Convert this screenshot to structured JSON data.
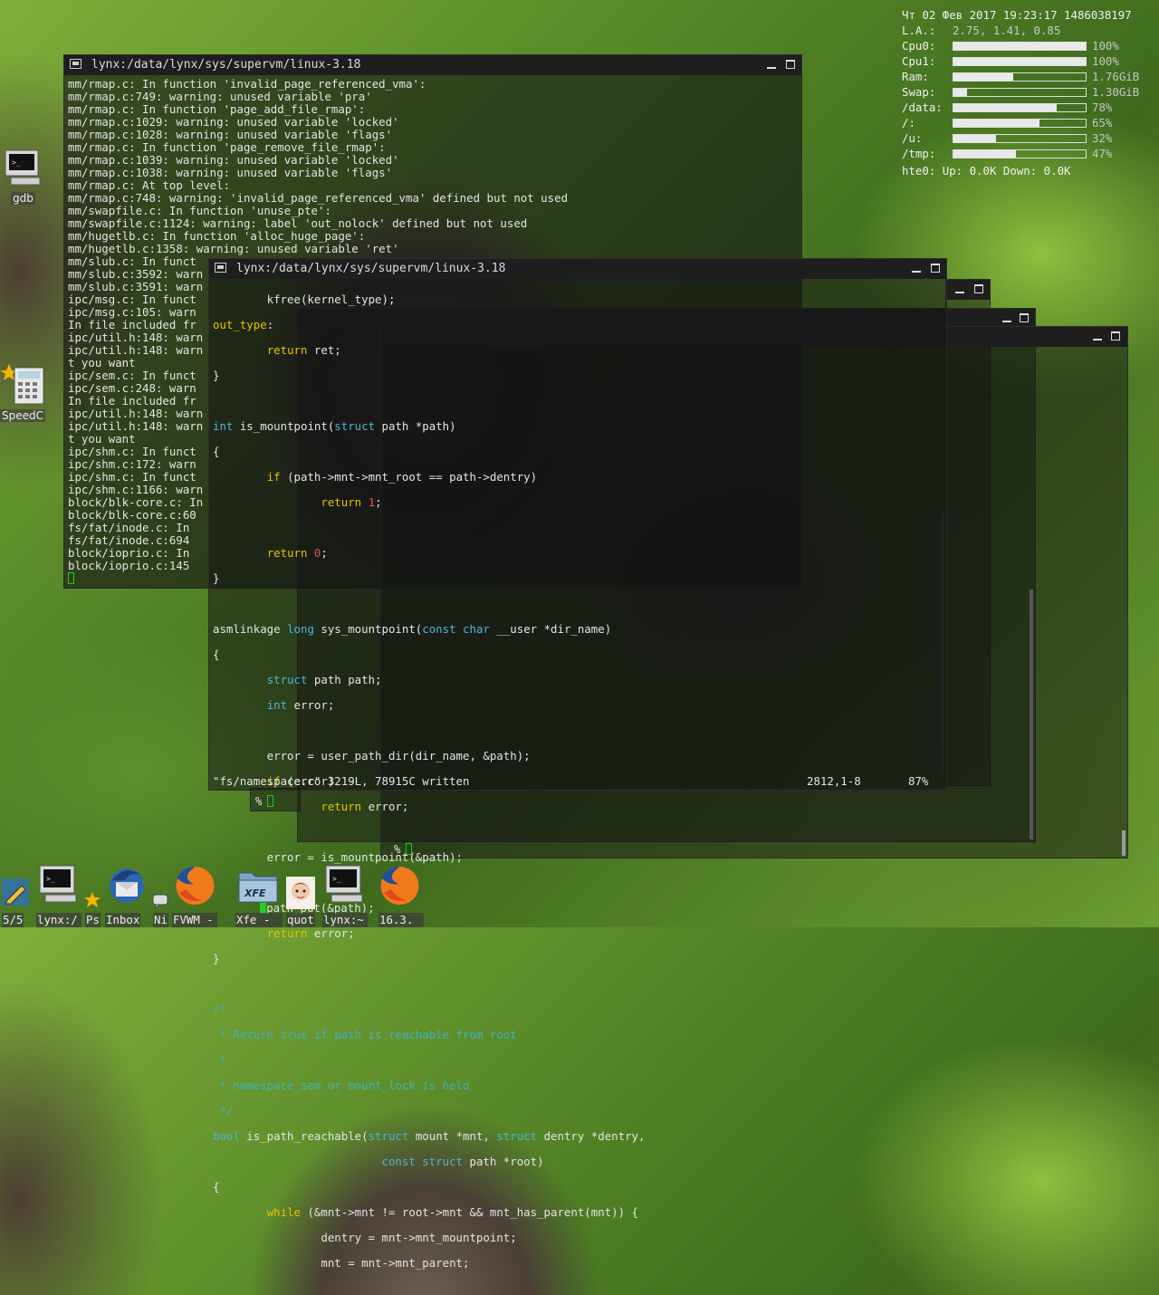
{
  "conky": {
    "datetime": "Чт 02 Фев 2017 19:23:17 1486038197",
    "load_label": "L.A.:",
    "load_value": "2.75, 1.41, 0.85",
    "meters": [
      {
        "label": "Cpu0:",
        "value": "100%",
        "level": 1.0
      },
      {
        "label": "Cpu1:",
        "value": "100%",
        "level": 1.0
      },
      {
        "label": "Ram:",
        "value": "1.76GiB",
        "level": 0.45
      },
      {
        "label": "Swap:",
        "value": "1.30GiB",
        "level": 0.1
      },
      {
        "label": "/data:",
        "value": "78%",
        "level": 0.78
      },
      {
        "label": "/:",
        "value": "65%",
        "level": 0.65
      },
      {
        "label": "/u:",
        "value": "32%",
        "level": 0.32
      },
      {
        "label": "/tmp:",
        "value": "47%",
        "level": 0.47
      }
    ],
    "net": "hte0: Up: 0.0K Down: 0.0K"
  },
  "window_back": {
    "title": "lynx:/data/lynx/sys/supervm/linux-3.18",
    "lines": [
      "mm/rmap.c: In function 'invalid_page_referenced_vma':",
      "mm/rmap.c:749: warning: unused variable 'pra'",
      "mm/rmap.c: In function 'page_add_file_rmap':",
      "mm/rmap.c:1029: warning: unused variable 'locked'",
      "mm/rmap.c:1028: warning: unused variable 'flags'",
      "mm/rmap.c: In function 'page_remove_file_rmap':",
      "mm/rmap.c:1039: warning: unused variable 'locked'",
      "mm/rmap.c:1038: warning: unused variable 'flags'",
      "mm/rmap.c: At top level:",
      "mm/rmap.c:748: warning: 'invalid_page_referenced_vma' defined but not used",
      "mm/swapfile.c: In function 'unuse_pte':",
      "mm/swapfile.c:1124: warning: label 'out_nolock' defined but not used",
      "mm/hugetlb.c: In function 'alloc_huge_page':",
      "mm/hugetlb.c:1358: warning: unused variable 'ret'",
      "mm/slub.c: In funct",
      "mm/slub.c:3592: warn",
      "mm/slub.c:3591: warn",
      "ipc/msg.c: In funct",
      "ipc/msg.c:105: warn",
      "In file included fr",
      "ipc/util.h:148: warn",
      "ipc/util.h:148: warn",
      "t you want",
      "ipc/sem.c: In funct",
      "ipc/sem.c:248: warn",
      "In file included fr",
      "ipc/util.h:148: warn",
      "ipc/util.h:148: warn",
      "t you want",
      "ipc/shm.c: In funct",
      "ipc/shm.c:172: warn",
      "ipc/shm.c: In funct",
      "ipc/shm.c:1166: warn",
      "block/blk-core.c: In",
      "block/blk-core.c:60",
      "fs/fat/inode.c: In",
      "fs/fat/inode.c:694",
      "block/ioprio.c: In",
      "block/ioprio.c:145"
    ]
  },
  "window_front": {
    "title": "lynx:/data/lynx/sys/supervm/linux-3.18",
    "status_file": "\"fs/namespace.c\" 3219L, 78915C written",
    "status_pos": "2812,1-8",
    "status_pct": "87%"
  },
  "small_windows": {
    "prompt": "%"
  },
  "desktop_icons": [
    {
      "label": "gdb"
    },
    {
      "label": "SpeedC"
    }
  ],
  "taskbar": {
    "pager": "5/5",
    "items": [
      {
        "label": "lynx:/"
      },
      {
        "label": "Ps"
      },
      {
        "label": "Inbox"
      },
      {
        "label": "Ni"
      },
      {
        "label": "FVWM -"
      },
      {
        "label": "Xfe -"
      },
      {
        "label": "quot"
      },
      {
        "label": "lynx:~"
      },
      {
        "label": "16.3."
      }
    ],
    "xfe_logo": "XFE"
  },
  "colors": {
    "keyword": "#e6c200",
    "type": "#4fb3d6",
    "number": "#e65050",
    "comment": "#3fb0c0",
    "cursor": "#22cc22"
  }
}
